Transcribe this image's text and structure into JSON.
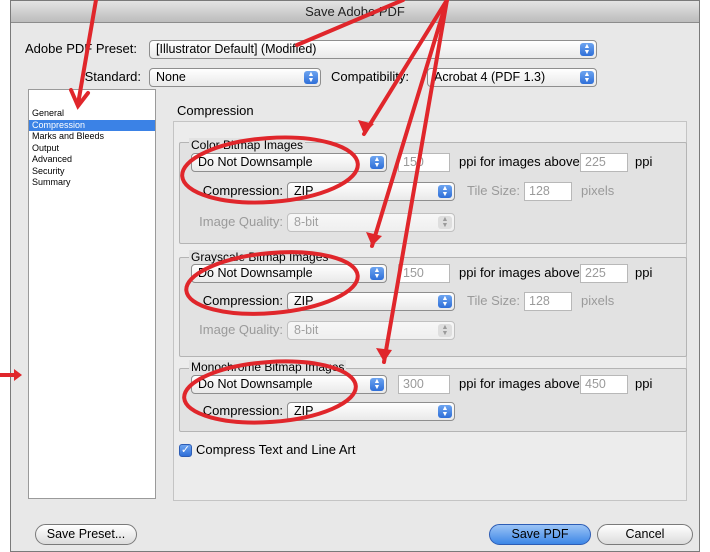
{
  "window": {
    "title": "Save Adobe PDF"
  },
  "preset": {
    "label": "Adobe PDF Preset:",
    "value": "[Illustrator Default] (Modified)"
  },
  "standard": {
    "label": "Standard:",
    "value": "None"
  },
  "compatibility": {
    "label": "Compatibility:",
    "value": "Acrobat 4 (PDF 1.3)"
  },
  "sidebar": {
    "items": [
      {
        "label": "General"
      },
      {
        "label": "Compression",
        "selected": true
      },
      {
        "label": "Marks and Bleeds"
      },
      {
        "label": "Output"
      },
      {
        "label": "Advanced"
      },
      {
        "label": "Security"
      },
      {
        "label": "Summary"
      }
    ]
  },
  "main": {
    "heading": "Compression",
    "color": {
      "title": "Color Bitmap Images",
      "downsample": "Do Not Downsample",
      "ppi": "150",
      "ppi_label": "ppi for images above",
      "above": "225",
      "unit": "ppi",
      "compression_label": "Compression:",
      "compression": "ZIP",
      "tile_label": "Tile Size:",
      "tile": "128",
      "tile_unit": "pixels",
      "quality_label": "Image Quality:",
      "quality": "8-bit"
    },
    "gray": {
      "title": "Grayscale Bitmap Images",
      "downsample": "Do Not Downsample",
      "ppi": "150",
      "ppi_label": "ppi for images above",
      "above": "225",
      "unit": "ppi",
      "compression_label": "Compression:",
      "compression": "ZIP",
      "tile_label": "Tile Size:",
      "tile": "128",
      "tile_unit": "pixels",
      "quality_label": "Image Quality:",
      "quality": "8-bit"
    },
    "mono": {
      "title": "Monochrome Bitmap Images",
      "downsample": "Do Not Downsample",
      "ppi": "300",
      "ppi_label": "ppi for images above",
      "above": "450",
      "unit": "ppi",
      "compression_label": "Compression:",
      "compression": "ZIP"
    },
    "compress_text": {
      "label": "Compress Text and Line Art",
      "checked": true
    }
  },
  "buttons": {
    "save_preset": "Save Preset...",
    "save_pdf": "Save PDF",
    "cancel": "Cancel"
  },
  "annotation_color": "#e0262b"
}
